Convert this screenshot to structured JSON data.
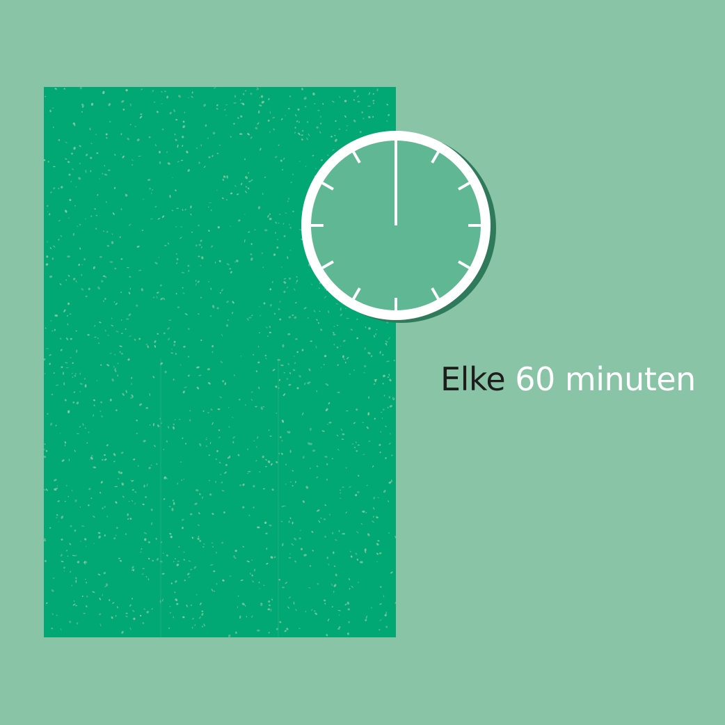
{
  "caption": {
    "word_dark": "Elke",
    "word_light": "60 minuten"
  },
  "clock": {
    "icon": "clock-icon",
    "tick_count": 12
  },
  "colors": {
    "background": "#89c4a6",
    "panel": "#02a873",
    "speckle": "#8ccaa6",
    "clock_face": "#5fb893",
    "clock_rim": "#ffffff",
    "clock_shadow": "#2f7a5a",
    "text_dark": "#1d1d1b",
    "text_light": "#ffffff"
  }
}
